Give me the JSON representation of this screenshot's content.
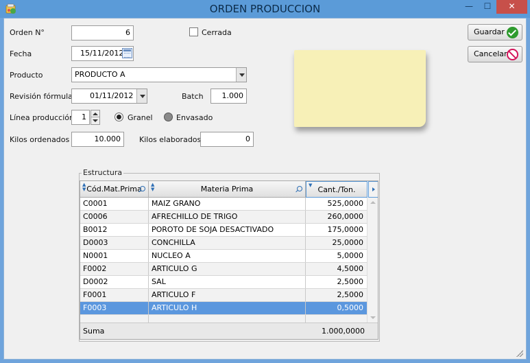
{
  "window": {
    "title": "ORDEN PRODUCCION",
    "minimize_glyph": "—",
    "maximize_glyph": "☐",
    "close_glyph": "✕"
  },
  "form": {
    "orden_label": "Orden N°",
    "orden_value": "6",
    "cerrada_label": "Cerrada",
    "cerrada_checked": false,
    "fecha_label": "Fecha",
    "fecha_value": "15/11/2012",
    "producto_label": "Producto",
    "producto_value": "PRODUCTO A",
    "revision_label": "Revisión fórmula",
    "revision_value": "01/11/2012",
    "batch_label": "Batch",
    "batch_value": "1.000",
    "linea_label": "Línea producción",
    "linea_value": "1",
    "granel_label": "Granel",
    "granel_selected": true,
    "envasado_label": "Envasado",
    "envasado_selected": false,
    "kilos_ordenados_label": "Kilos ordenados",
    "kilos_ordenados_value": "10.000",
    "kilos_elaborados_label": "Kilos elaborados",
    "kilos_elaborados_value": "0"
  },
  "buttons": {
    "guardar": "Guardar",
    "cancelar": "Cancelar"
  },
  "estructura": {
    "title": "Estructura",
    "columns": [
      "Cód.Mat.Prima",
      "Materia Prima",
      "Cant./Ton."
    ],
    "rows": [
      {
        "codigo": "C0001",
        "materia": "MAIZ GRANO",
        "cantidad": "525,0000"
      },
      {
        "codigo": "C0006",
        "materia": "AFRECHILLO DE TRIGO",
        "cantidad": "260,0000"
      },
      {
        "codigo": "B0012",
        "materia": "POROTO DE SOJA DESACTIVADO",
        "cantidad": "175,0000"
      },
      {
        "codigo": "D0003",
        "materia": "CONCHILLA",
        "cantidad": "25,0000"
      },
      {
        "codigo": "N0001",
        "materia": "NUCLEO A",
        "cantidad": "5,0000"
      },
      {
        "codigo": "F0002",
        "materia": "ARTICULO G",
        "cantidad": "4,5000"
      },
      {
        "codigo": "D0002",
        "materia": "SAL",
        "cantidad": "2,5000"
      },
      {
        "codigo": "F0001",
        "materia": "ARTICULO F",
        "cantidad": "2,5000"
      },
      {
        "codigo": "F0003",
        "materia": "ARTICULO H",
        "cantidad": "0,5000"
      }
    ],
    "selected_row": "F0003",
    "footer_label": "Suma",
    "footer_total": "1.000,0000"
  },
  "colors": {
    "titlebar": "#5b9bd8",
    "close_button": "#c7504a",
    "selection": "#5b97de",
    "note": "#f7f0b7"
  }
}
